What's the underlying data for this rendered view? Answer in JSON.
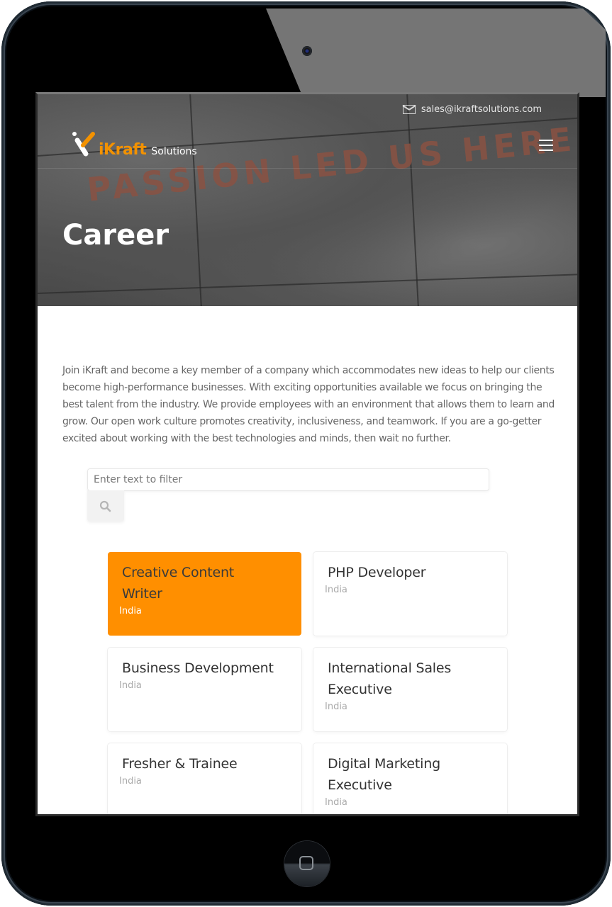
{
  "header": {
    "email": "sales@ikraftsolutions.com",
    "logo": {
      "brand": "iKraft",
      "suffix": "Solutions"
    },
    "menu_icon": "hamburger-icon",
    "hero_image_text": "PASSION LED US HERE"
  },
  "page": {
    "title": "Career",
    "intro": "Join iKraft and become a key member of a company which accommodates new ideas to help our clients become high-performance businesses. With exciting opportunities available we focus on bringing the best talent from the industry. We provide employees with an environment that allows them to learn and grow. Our open work culture promotes creativity, inclusiveness, and teamwork. If you are a go-getter excited about working with the best technologies and minds, then wait no further."
  },
  "filter": {
    "placeholder": "Enter text to filter",
    "value": "",
    "search_icon": "search-icon"
  },
  "jobs": [
    {
      "title": "Creative Content Writer",
      "location": "India",
      "active": true
    },
    {
      "title": "PHP Developer",
      "location": "India",
      "active": false
    },
    {
      "title": "Business Development",
      "location": "India",
      "active": false
    },
    {
      "title": "International Sales Executive",
      "location": "India",
      "active": false
    },
    {
      "title": "Fresher & Trainee",
      "location": "India",
      "active": false
    },
    {
      "title": "Digital Marketing Executive",
      "location": "India",
      "active": false
    }
  ],
  "colors": {
    "accent": "#ff8f00",
    "logo_orange": "#f39200",
    "text": "#666666",
    "muted": "#aaaaaa"
  }
}
